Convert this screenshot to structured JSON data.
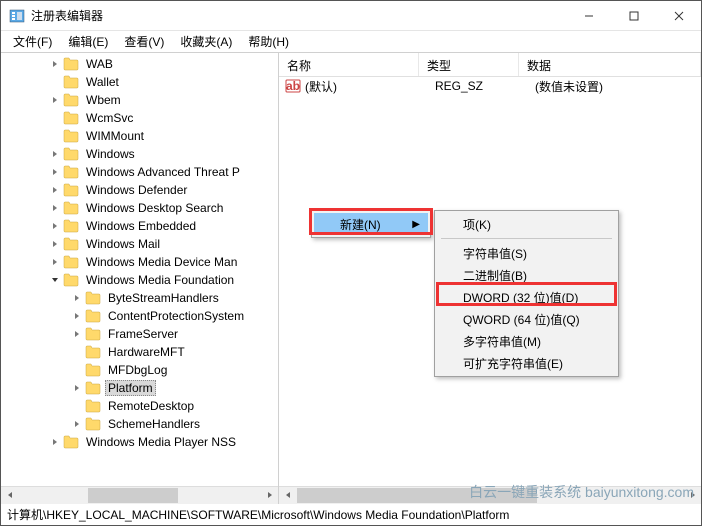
{
  "window": {
    "title": "注册表编辑器"
  },
  "winbtns": {
    "min": "minimize",
    "max": "maximize",
    "close": "close"
  },
  "menubar": [
    {
      "label": "文件(F)"
    },
    {
      "label": "编辑(E)"
    },
    {
      "label": "查看(V)"
    },
    {
      "label": "收藏夹(A)"
    },
    {
      "label": "帮助(H)"
    }
  ],
  "tree": [
    {
      "level": 4,
      "expand": "right",
      "label": "WAB"
    },
    {
      "level": 4,
      "expand": "none",
      "label": "Wallet"
    },
    {
      "level": 4,
      "expand": "right",
      "label": "Wbem"
    },
    {
      "level": 4,
      "expand": "none",
      "label": "WcmSvc"
    },
    {
      "level": 4,
      "expand": "none",
      "label": "WIMMount"
    },
    {
      "level": 4,
      "expand": "right",
      "label": "Windows"
    },
    {
      "level": 4,
      "expand": "right",
      "label": "Windows Advanced Threat P"
    },
    {
      "level": 4,
      "expand": "right",
      "label": "Windows Defender"
    },
    {
      "level": 4,
      "expand": "right",
      "label": "Windows Desktop Search"
    },
    {
      "level": 4,
      "expand": "right",
      "label": "Windows Embedded"
    },
    {
      "level": 4,
      "expand": "right",
      "label": "Windows Mail"
    },
    {
      "level": 4,
      "expand": "right",
      "label": "Windows Media Device Man"
    },
    {
      "level": 4,
      "expand": "down",
      "label": "Windows Media Foundation"
    },
    {
      "level": 5,
      "expand": "right",
      "label": "ByteStreamHandlers"
    },
    {
      "level": 5,
      "expand": "right",
      "label": "ContentProtectionSystem"
    },
    {
      "level": 5,
      "expand": "right",
      "label": "FrameServer"
    },
    {
      "level": 5,
      "expand": "none",
      "label": "HardwareMFT"
    },
    {
      "level": 5,
      "expand": "none",
      "label": "MFDbgLog"
    },
    {
      "level": 5,
      "expand": "right",
      "label": "Platform",
      "selected": true
    },
    {
      "level": 5,
      "expand": "none",
      "label": "RemoteDesktop"
    },
    {
      "level": 5,
      "expand": "right",
      "label": "SchemeHandlers"
    },
    {
      "level": 4,
      "expand": "right",
      "label": "Windows Media Player NSS"
    }
  ],
  "list": {
    "headers": {
      "name": "名称",
      "type": "类型",
      "data": "数据"
    },
    "rows": [
      {
        "name": "(默认)",
        "type": "REG_SZ",
        "data": "(数值未设置)"
      }
    ]
  },
  "context_primary": {
    "items": [
      {
        "label": "新建(N)",
        "submenu": true,
        "hover": true
      }
    ]
  },
  "context_submenu": {
    "items": [
      {
        "label": "项(K)"
      },
      {
        "sep": true
      },
      {
        "label": "字符串值(S)"
      },
      {
        "label": "二进制值(B)"
      },
      {
        "label": "DWORD (32 位)值(D)",
        "highlight": true
      },
      {
        "label": "QWORD (64 位)值(Q)"
      },
      {
        "label": "多字符串值(M)"
      },
      {
        "label": "可扩充字符串值(E)"
      }
    ]
  },
  "statusbar": {
    "path": "计算机\\HKEY_LOCAL_MACHINE\\SOFTWARE\\Microsoft\\Windows Media Foundation\\Platform"
  },
  "watermark": "白云一键重装系统 baiyunxitong.com"
}
